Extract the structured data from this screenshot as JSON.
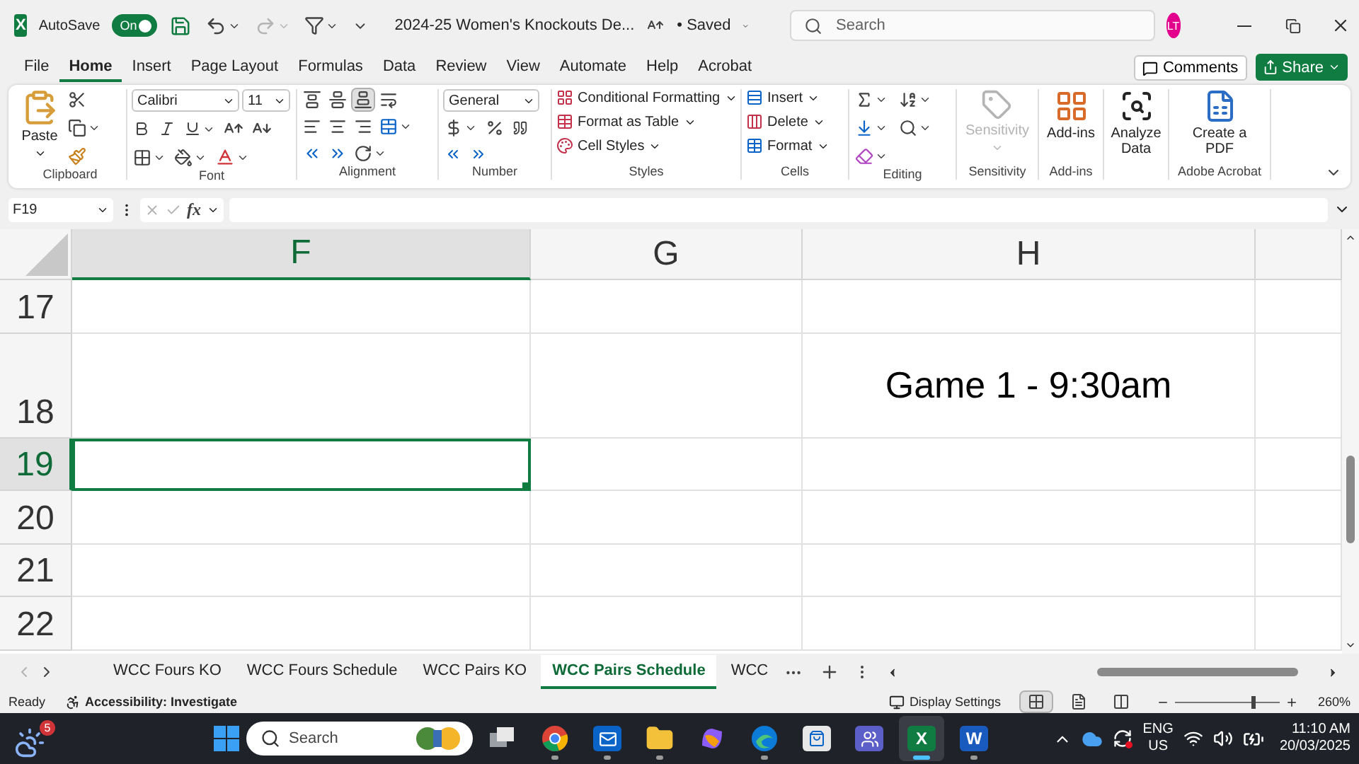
{
  "title_bar": {
    "app_letter": "X",
    "autosave_label": "AutoSave",
    "autosave": {
      "on": true,
      "label": "On"
    },
    "redo_disabled": true,
    "document_title": "2024-25 Women's Knockouts De...",
    "saved": "• Saved",
    "search": {
      "placeholder": "Search"
    },
    "avatar": "LT"
  },
  "menu_tabs": [
    {
      "label": "File",
      "selected": false
    },
    {
      "label": "Home",
      "selected": true
    },
    {
      "label": "Insert",
      "selected": false
    },
    {
      "label": "Page Layout",
      "selected": false
    },
    {
      "label": "Formulas",
      "selected": false
    },
    {
      "label": "Data",
      "selected": false
    },
    {
      "label": "Review",
      "selected": false
    },
    {
      "label": "View",
      "selected": false
    },
    {
      "label": "Automate",
      "selected": false
    },
    {
      "label": "Help",
      "selected": false
    },
    {
      "label": "Acrobat",
      "selected": false
    }
  ],
  "comments_button": "Comments",
  "share_button": "Share",
  "ribbon": {
    "clipboard": {
      "label": "Clipboard",
      "paste": "Paste"
    },
    "font": {
      "label": "Font",
      "font_name": "Calibri",
      "font_size": "11"
    },
    "alignment": {
      "label": "Alignment",
      "vertical_align": [
        {
          "selected": false
        },
        {
          "selected": false
        },
        {
          "selected": true
        }
      ]
    },
    "number": {
      "label": "Number",
      "format": "General"
    },
    "styles": {
      "label": "Styles",
      "commands": [
        "Conditional Formatting",
        "Format as Table",
        "Cell Styles"
      ]
    },
    "cells": {
      "label": "Cells",
      "commands": [
        "Insert",
        "Delete",
        "Format"
      ]
    },
    "editing": {
      "label": "Editing"
    },
    "sensitivity": {
      "label": "Sensitivity",
      "button": "Sensitivity",
      "disabled": true
    },
    "addins": {
      "label": "Add-ins",
      "button": "Add-ins"
    },
    "analyze": {
      "button": "Analyze Data"
    },
    "acrobat": {
      "label": "Adobe Acrobat",
      "button": "Create a PDF"
    }
  },
  "formula_bar": {
    "name_box": "F19",
    "fx": "fx"
  },
  "grid": {
    "columns": [
      {
        "label": "F",
        "selected": true
      },
      {
        "label": "G",
        "selected": false
      },
      {
        "label": "H",
        "selected": false
      }
    ],
    "rows": [
      {
        "number": "17",
        "selected": false
      },
      {
        "number": "18",
        "selected": false,
        "h_value": "Game 1 - 9:30am"
      },
      {
        "number": "19",
        "selected": true
      },
      {
        "number": "20",
        "selected": false
      },
      {
        "number": "21",
        "selected": false
      },
      {
        "number": "22",
        "selected": false
      }
    ]
  },
  "sheet_tabs": [
    {
      "label": "WCC Fours KO",
      "selected": false
    },
    {
      "label": "WCC Fours Schedule",
      "selected": false
    },
    {
      "label": "WCC Pairs KO",
      "selected": false
    },
    {
      "label": "WCC Pairs Schedule",
      "selected": true
    },
    {
      "label": "WCC",
      "selected": false
    }
  ],
  "status_bar": {
    "ready": "Ready",
    "accessibility": "Accessibility: Investigate",
    "display_settings": "Display Settings",
    "views": [
      {
        "selected": true
      },
      {
        "selected": false
      },
      {
        "selected": false
      }
    ],
    "zoom": {
      "level": 0.73
    },
    "zoom_label": "260%"
  },
  "taskbar": {
    "weather_badge": "5",
    "search": {
      "placeholder": "Search"
    },
    "apps": [
      {
        "kind": "taskview",
        "running": false,
        "active": false
      },
      {
        "kind": "chrome",
        "running": true,
        "active": false
      },
      {
        "kind": "outlook",
        "running": true,
        "active": false
      },
      {
        "kind": "explorer",
        "running": true,
        "active": false
      },
      {
        "kind": "copilot",
        "running": false,
        "active": false
      },
      {
        "kind": "edge",
        "running": true,
        "active": false
      },
      {
        "kind": "store",
        "running": false,
        "active": false
      },
      {
        "kind": "teams",
        "running": false,
        "active": false
      },
      {
        "kind": "excel",
        "letter": "X",
        "running": true,
        "active": true
      },
      {
        "kind": "word",
        "letter": "W",
        "running": true,
        "active": false
      }
    ],
    "language": "ENG",
    "region": "US",
    "time": "11:10 AM",
    "date": "20/03/2025"
  }
}
